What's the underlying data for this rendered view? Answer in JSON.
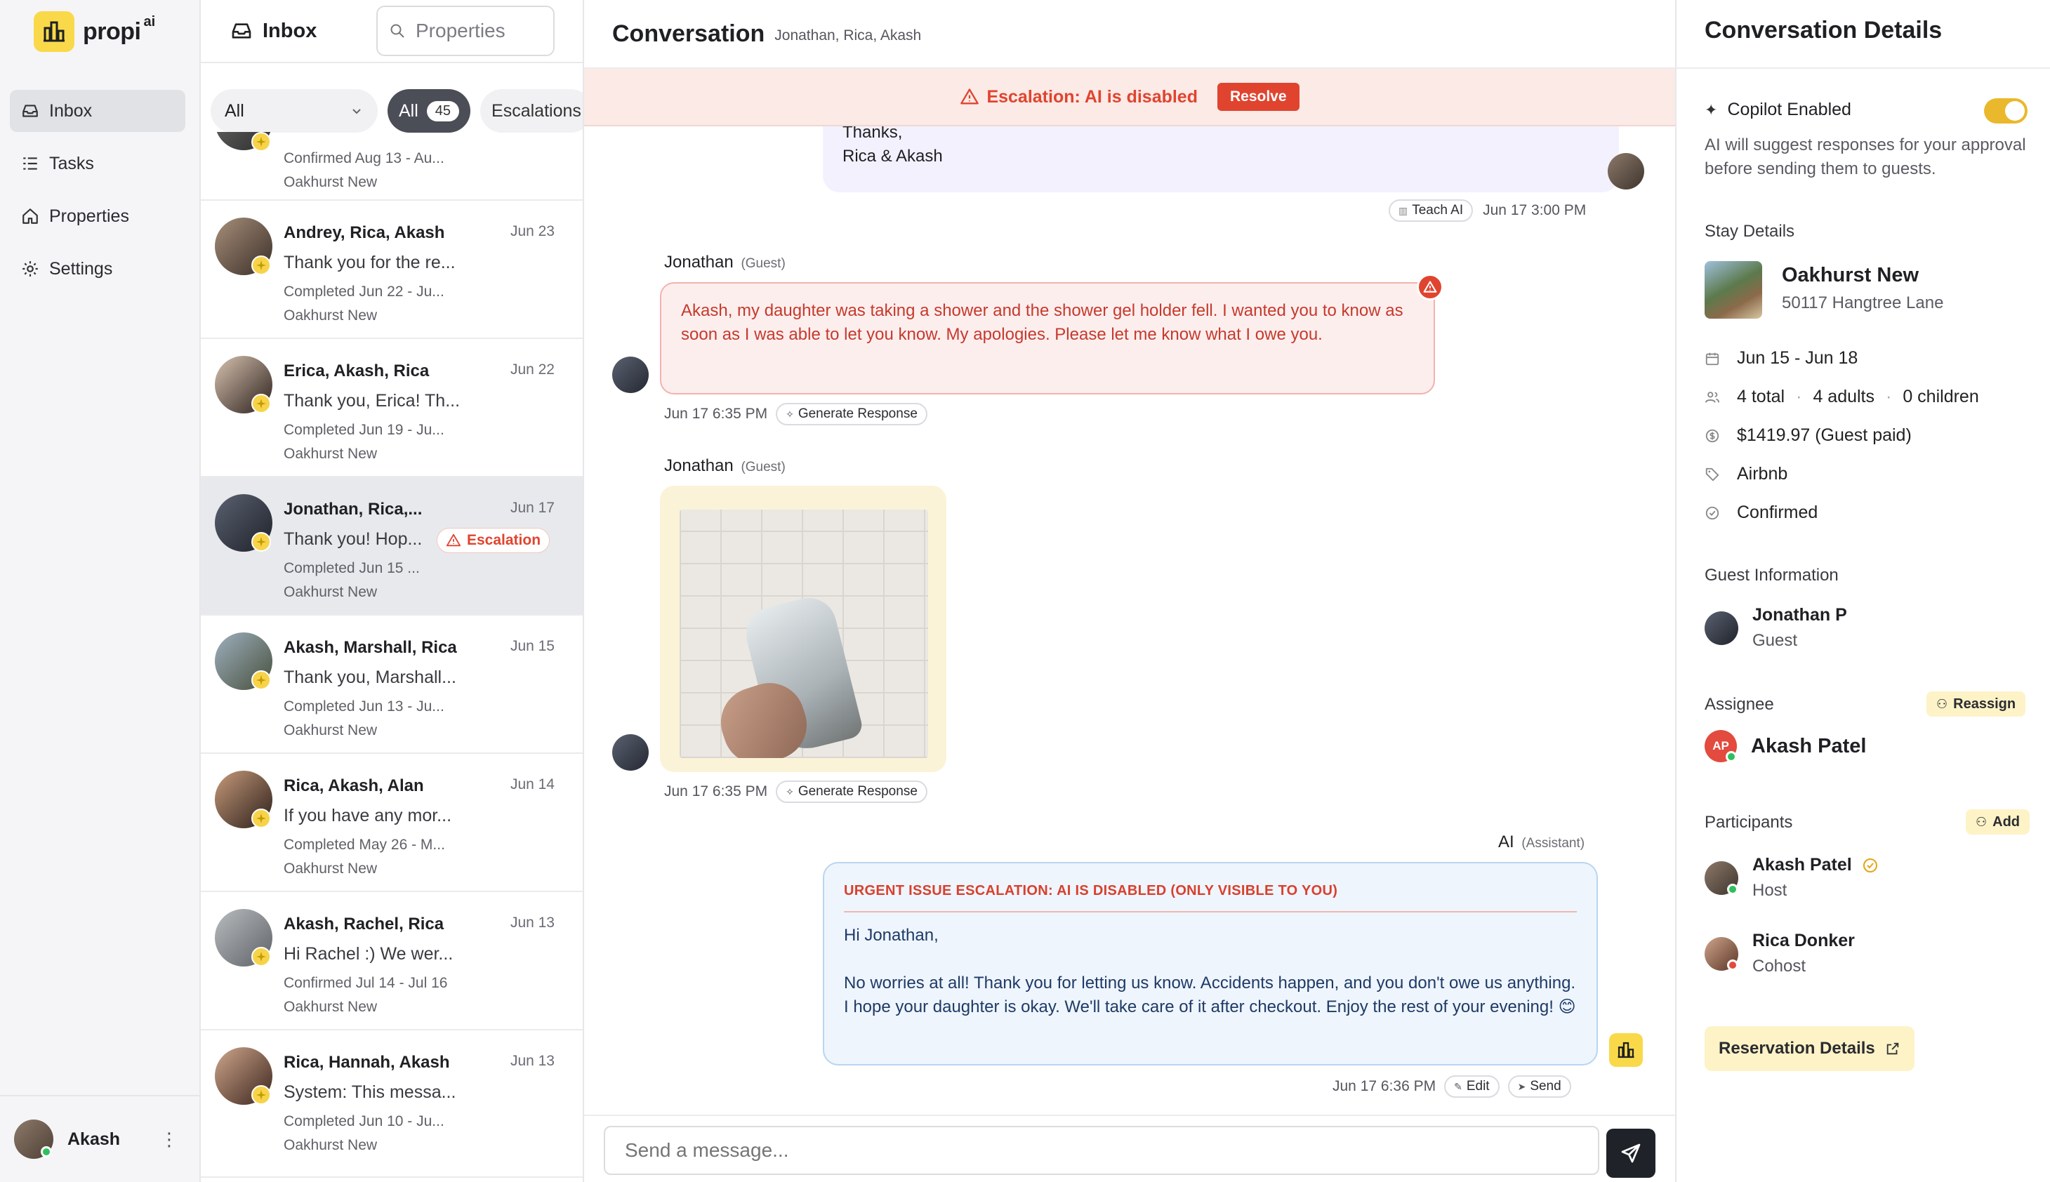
{
  "app": {
    "name": "propi",
    "name_sup": "ai"
  },
  "nav": {
    "items": [
      {
        "label": "Inbox",
        "icon": "inbox-icon"
      },
      {
        "label": "Tasks",
        "icon": "tasks-icon"
      },
      {
        "label": "Properties",
        "icon": "home-icon"
      },
      {
        "label": "Settings",
        "icon": "gear-icon"
      }
    ],
    "user": {
      "name": "Akash"
    }
  },
  "list": {
    "title": "Inbox",
    "search_placeholder": "Properties",
    "filter_select": "All",
    "chips": {
      "all_label": "All",
      "all_count": "45",
      "escalations_label": "Escalations"
    },
    "rows": [
      {
        "names": "",
        "date": "",
        "snippet": "",
        "stay": "Confirmed Aug 13 - Au...",
        "property": "Oakhurst New"
      },
      {
        "names": "Andrey, Rica, Akash",
        "date": "Jun 23",
        "snippet": "Thank you for the re...",
        "stay": "Completed Jun 22 - Ju...",
        "property": "Oakhurst New"
      },
      {
        "names": "Erica, Akash, Rica",
        "date": "Jun 22",
        "snippet": "Thank you, Erica! Th...",
        "stay": "Completed Jun 19 - Ju...",
        "property": "Oakhurst New"
      },
      {
        "names": "Jonathan, Rica,...",
        "date": "Jun 17",
        "snippet": "Thank you! Hop...",
        "stay": "Completed Jun 15 ...",
        "property": "Oakhurst New",
        "badge": "Escalation"
      },
      {
        "names": "Akash, Marshall, Rica",
        "date": "Jun 15",
        "snippet": "Thank you, Marshall...",
        "stay": "Completed Jun 13 - Ju...",
        "property": "Oakhurst New"
      },
      {
        "names": "Rica, Akash, Alan",
        "date": "Jun 14",
        "snippet": "If you have any mor...",
        "stay": "Completed May 26 - M...",
        "property": "Oakhurst New"
      },
      {
        "names": "Akash, Rachel, Rica",
        "date": "Jun 13",
        "snippet": "Hi Rachel :) We wer...",
        "stay": "Confirmed Jul 14 - Jul 16",
        "property": "Oakhurst New"
      },
      {
        "names": "Rica, Hannah, Akash",
        "date": "Jun 13",
        "snippet": "System: This messa...",
        "stay": "Completed Jun 10 - Ju...",
        "property": "Oakhurst New"
      }
    ]
  },
  "conversation": {
    "title": "Conversation",
    "participants": "Jonathan, Rica, Akash",
    "escalation": {
      "text": "Escalation: AI is disabled",
      "button": "Resolve"
    },
    "host_msg": {
      "lines": [
        "Thanks,",
        "Rica & Akash"
      ],
      "teach": "Teach AI",
      "time": "Jun 17 3:00 PM"
    },
    "guest_msg1": {
      "sender": "Jonathan",
      "role": "(Guest)",
      "text": "Akash, my daughter was taking a shower and the shower gel holder fell. I wanted you to know as soon as I was able to let you know. My apologies. Please let me know what I owe you.",
      "time": "Jun 17 6:35 PM",
      "action": "Generate Response"
    },
    "guest_msg2": {
      "sender": "Jonathan",
      "role": "(Guest)",
      "time": "Jun 17 6:35 PM",
      "action": "Generate Response"
    },
    "ai_msg": {
      "sender": "AI",
      "role": "(Assistant)",
      "header": "URGENT ISSUE ESCALATION: AI IS DISABLED (ONLY VISIBLE TO YOU)",
      "greeting": "Hi Jonathan,",
      "body": "No worries at all! Thank you for letting us know. Accidents happen, and you don't owe us anything. I hope your daughter is okay. We'll take care of it after checkout. Enjoy the rest of your evening! 😊",
      "time": "Jun 17 6:36 PM",
      "edit": "Edit",
      "send": "Send"
    },
    "input_placeholder": "Send a message..."
  },
  "details": {
    "title": "Conversation Details",
    "copilot": {
      "label": "Copilot Enabled",
      "desc": "AI will suggest responses for your approval before sending them to guests.",
      "enabled": true
    },
    "stay": {
      "section": "Stay Details",
      "property": "Oakhurst New",
      "address": "50117 Hangtree Lane",
      "dates": "Jun 15 - Jun 18",
      "total": "4 total",
      "adults": "4 adults",
      "children": "0 children",
      "price": "$1419.97 (Guest paid)",
      "channel": "Airbnb",
      "status": "Confirmed"
    },
    "guest": {
      "section": "Guest Information",
      "name": "Jonathan P",
      "role": "Guest"
    },
    "assignee": {
      "section": "Assignee",
      "button": "Reassign",
      "initials": "AP",
      "name": "Akash Patel"
    },
    "participants": {
      "section": "Participants",
      "button": "Add",
      "list": [
        {
          "name": "Akash Patel",
          "role": "Host"
        },
        {
          "name": "Rica Donker",
          "role": "Cohost"
        }
      ]
    },
    "reservation_button": "Reservation Details"
  },
  "colors": {
    "brand": "#f9d94a",
    "escalation": "#e0442f",
    "ai_bubble": "#eef5fd",
    "guest_bubble": "#fdeeee"
  }
}
